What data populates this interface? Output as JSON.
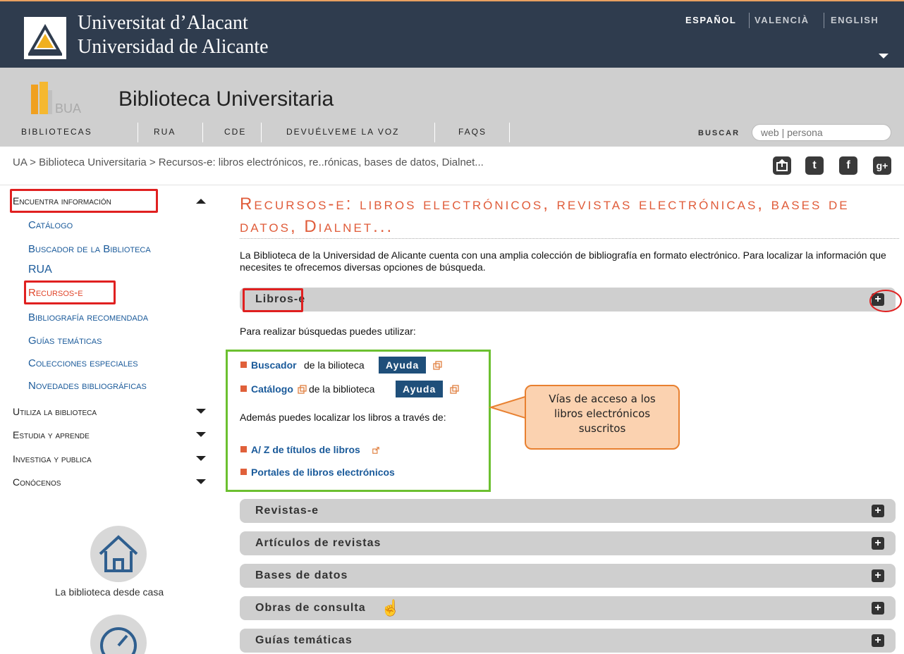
{
  "university": {
    "name_line1": "Universitat d’Alacant",
    "name_line2": "Universidad de Alicante"
  },
  "languages": [
    "ESPAÑOL",
    "VALENCIÀ",
    "ENGLISH"
  ],
  "library": {
    "title": "Biblioteca Universitaria",
    "logo_text": "BUA"
  },
  "nav": [
    "BIBLIOTECAS",
    "RUA",
    "CDE",
    "DEVUÉLVEME LA VOZ",
    "FAQS"
  ],
  "search": {
    "label": "BUSCAR",
    "placeholder": "web | persona"
  },
  "breadcrumb": "UA > Biblioteca Universitaria > Recursos-e: libros electrónicos, re..rónicas, bases de datos, Dialnet...",
  "social": [
    "share-icon",
    "twitter-icon",
    "facebook-icon",
    "google-plus-icon"
  ],
  "sidebar": {
    "sections": [
      {
        "label": "Encuentra información",
        "expanded": true,
        "items": [
          "Catálogo",
          "Buscador de la Biblioteca",
          "RUA",
          "Recursos-e",
          "Bibliografía recomendada",
          "Guías temáticas",
          "Colecciones especiales",
          "Novedades bibliográficas"
        ]
      },
      {
        "label": "Utiliza la biblioteca",
        "expanded": false
      },
      {
        "label": "Estudia y aprende",
        "expanded": false
      },
      {
        "label": "Investiga y publica",
        "expanded": false
      },
      {
        "label": "Conócenos",
        "expanded": false
      }
    ],
    "active_item": "Recursos-e",
    "home_caption": "La biblioteca desde casa"
  },
  "main": {
    "title": "Recursos-e: libros electrónicos, revistas electrónicas, bases de datos, Dialnet...",
    "intro": "La Biblioteca de la Universidad de Alicante cuenta con una amplia colección de bibliografía en formato electrónico. Para localizar la información que necesites te ofrecemos diversas opciones de búsqueda.",
    "open_section": {
      "label": "Libros-e",
      "lead": "Para realizar búsquedas puedes utilizar:",
      "line1_link": "Buscador",
      "line1_text": "de la bilioteca",
      "line2_link": "Catálogo",
      "line2_text": "de la biblioteca",
      "ayuda": "Ayuda",
      "also": "Además puedes localizar los libros a través de:",
      "link_az": "A/ Z de títulos de libros",
      "link_portales": "Portales de libros electrónicos"
    },
    "sections": [
      "Revistas-e",
      "Artículos de revistas",
      "Bases de datos",
      "Obras de consulta",
      "Guías temáticas"
    ]
  },
  "callout": {
    "line1": "Vías de acceso a los",
    "line2": "libros electrónicos",
    "line3": "suscritos"
  },
  "colors": {
    "topbar": "#2f3c4e",
    "accent_orange": "#e05c3a",
    "link_blue": "#1a5a9a",
    "annotation_red": "#e02020",
    "annotation_green": "#6cc030",
    "callout_fill": "#fbd2b0"
  }
}
